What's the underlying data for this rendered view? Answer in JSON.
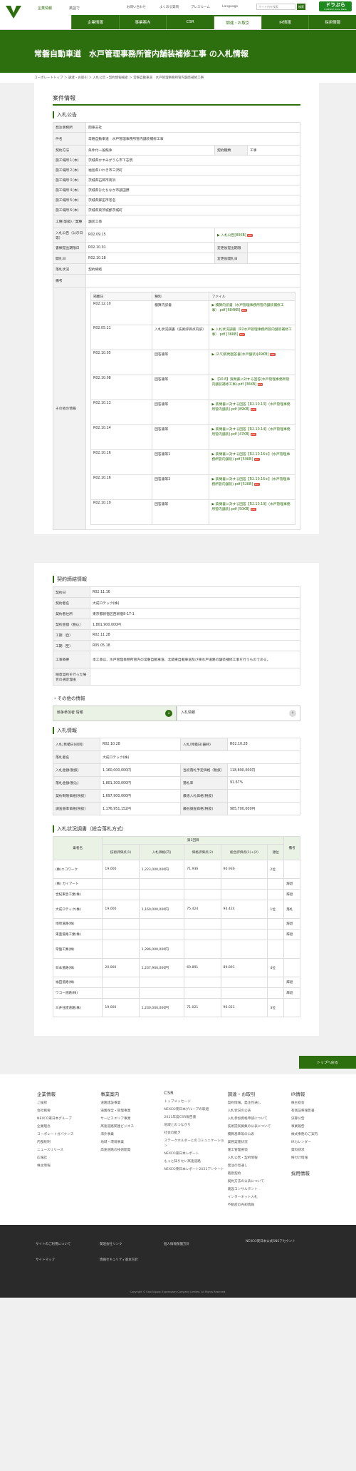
{
  "header": {
    "logo_alt": "NEXCO東日本",
    "group": "企業情報",
    "lang_label": "英語で",
    "util": [
      "お問い合わせ",
      "よくある質問",
      "プレスルーム",
      "Language"
    ],
    "search_placeholder": "サイト内を検索",
    "search_button": "検索",
    "brand": "ドラぷら",
    "brand_sub": "E-NEXCO Drive Plaza"
  },
  "nav": [
    "企業情報",
    "事業案内",
    "CSR",
    "調達・お取引",
    "IR情報",
    "採用情報"
  ],
  "page": {
    "title": "常磐自動車道　水戸管理事務所管内舗装補修工事 の入札情報"
  },
  "breadcrumb": "コーポレートトップ ＞ 調達・お取引 ＞ 入札公告・契約情報検索 ＞ 常磐自動車道　水戸管理事務所管内舗装補修工事",
  "case": {
    "heading": "案件情報",
    "notice_heading": "入札公告",
    "rows": [
      {
        "l": "発注事務所",
        "v": "関東支社"
      },
      {
        "l": "件名",
        "v": "常磐自動車道　水戸管理事務所管内舗装補修工事"
      },
      {
        "l": "契約方法",
        "v": "条件付一般競争",
        "l2": "契約種類",
        "v2": "工事"
      },
      {
        "l": "施工場所１(本)",
        "v": "茨城県かすみがうら市下志筑"
      },
      {
        "l": "施工場所２(本)",
        "v": "福島県いわき市三沢町"
      },
      {
        "l": "施工場所３(本)",
        "v": "茨城県石岡市高浜"
      },
      {
        "l": "施工場所４(本)",
        "v": "茨城県ひたちなか市部田野"
      },
      {
        "l": "施工場所５(本)",
        "v": "茨城県鉾田市巻名"
      },
      {
        "l": "施工場所６(本)",
        "v": "茨城県東茨城郡茨城町"
      },
      {
        "l": "工種(等級)／業種",
        "v": "舗装工事"
      }
    ],
    "koukoku_date_label": "入札公告（公示日等）",
    "koukoku_date": "R02.09.15",
    "koukoku_file": "入札公告[80KB]",
    "submit_label": "書類提出期限日",
    "submit": "R02.10.01",
    "change1_label": "変更後提出期限",
    "change1": "",
    "open_label": "開札日",
    "open": "R02.10.28",
    "change2_label": "変更後開札日",
    "change2": "",
    "result_label": "落札状況",
    "result": "契約締結",
    "note_label": "備考",
    "note": "",
    "other_label": "その他の情報",
    "other_headers": [
      "掲載日",
      "種別",
      "ファイル"
    ],
    "other": [
      {
        "d": "R02.12.10",
        "t": "積算内訳書",
        "f": "積算内訳書（水戸管理事務所管内舗装補修工事）.pdf [684KB]"
      },
      {
        "d": "R02.05.21",
        "t": "入札状況調書（技術評価点内訳）",
        "f": "入札状況調書（R2水戸管理事務所管内舗装補修工事）.pdf [36KB]"
      },
      {
        "d": "R02.10.05",
        "t": "回答書等",
        "f": "(2.5)質問回答書(水戸舗装)[49KB]"
      },
      {
        "d": "R02.10.08",
        "t": "回答書等",
        "f": "【10.8】質問書に対する回答(水戸管理事務所管内舗装補修工事).pdf [36KB]"
      },
      {
        "d": "R02.10.13",
        "t": "回答書等",
        "f": "質問書に対する回答【R2.10.13】(水戸管理事務所管内舗装).pdf [89KB]"
      },
      {
        "d": "R02.10.14",
        "t": "回答書等",
        "f": "質問書に対する回答【R2.10.14】(水戸管理事務所管内舗装).pdf [47KB]"
      },
      {
        "d": "R02.10.16",
        "t": "回答書等1",
        "f": "質問書に対する回答【R2.10.16①】(水戸管理事務所管内舗装).pdf [59KB]"
      },
      {
        "d": "R02.10.16",
        "t": "回答書等2",
        "f": "質問書に対する回答【R2.10.16②】(水戸管理事務所管内舗装).pdf [52KB]"
      },
      {
        "d": "R02.10.19",
        "t": "回答書等",
        "f": "質問書に対する回答【R2.10.19】(水戸管理事務所管内舗装).pdf [50KB]"
      }
    ]
  },
  "contract": {
    "heading": "契約締結情報",
    "rows": [
      {
        "l": "契約日",
        "v": "R02.11.16"
      },
      {
        "l": "契約者名",
        "v": "大成ロテック(株)"
      },
      {
        "l": "契約者住所",
        "v": "東京都新宿区西新宿8-17-1"
      },
      {
        "l": "契約金額（税込）",
        "v": "1,801,900,000円"
      },
      {
        "l": "工期（自）",
        "v": "R02.11.28"
      },
      {
        "l": "工期（至）",
        "v": "R05.05.18"
      },
      {
        "l": "工事概要",
        "v": "本工事は、水戸管理事務所管内の常磐自動車道、北関東自動車道及び東水戸道路の舗装補修工事を行うものである。"
      },
      {
        "l": "随意契約を行った場合の選定理由",
        "v": ""
      }
    ]
  },
  "other_info": {
    "heading": "その他の情報",
    "tabs": [
      "競争参加者 情報",
      "入札情報"
    ],
    "tab_icons": [
      "↓",
      "↑"
    ]
  },
  "bid": {
    "heading": "入札情報",
    "rows": [
      {
        "l": "入札/見積日(初回)",
        "v": "R02.10.28",
        "l2": "入札/見積日(最終)",
        "v2": "R02.10.28"
      },
      {
        "l": "落札者名",
        "v": "大成ロテック(株)",
        "l2": "",
        "v2": ""
      },
      {
        "l": "入札金額(税抜)",
        "v": "1,160,000,000円",
        "l2": "当初落札予定価格（税抜）",
        "v2": "118,890,000円"
      },
      {
        "l": "落札金額(税込)",
        "v": "1,801,300,000円",
        "l2": "落札率",
        "v2": "91.67%"
      },
      {
        "l": "契約制限価格(税抜)",
        "v": "1,697,900,000円",
        "l2": "最適入札価格(税抜)",
        "v2": ""
      },
      {
        "l": "調査基準価格(税抜)",
        "v": "1,176,951,152円",
        "l2": "最低調査価格(税抜)",
        "v2": "985,700,000円"
      }
    ]
  },
  "status": {
    "heading": "入札状況調書（総合落札方式）",
    "round": "第1回目",
    "headers": [
      "業者名",
      "技術評価点(1)",
      "入札価格(円)",
      "価格評価点(2)",
      "総合評価点(1)+(2)",
      "順位",
      "備考"
    ],
    "rows": [
      [
        "(株)エコワーク",
        "19.000",
        "1,223,000,000円",
        "71.936",
        "90.936",
        "2位",
        ""
      ],
      [
        "(株) ガイアート",
        "",
        "",
        "",
        "",
        "",
        "辞退"
      ],
      [
        "世紀東急工業(株)",
        "",
        "",
        "",
        "",
        "",
        "辞退"
      ],
      [
        "大成ロテック(株)",
        "19.000",
        "1,160,000,000円",
        "75.424",
        "94.424",
        "1位",
        "落札"
      ],
      [
        "地崎道路(株)",
        "",
        "",
        "",
        "",
        "",
        "辞退"
      ],
      [
        "東亜道路工業(株)",
        "",
        "",
        "",
        "",
        "",
        "辞退"
      ],
      [
        "常盤工業(株)",
        "",
        "1,286,000,000円",
        "",
        "",
        "",
        ""
      ],
      [
        "日本道路(株)",
        "20.000",
        "1,237,900,000円",
        "69.891",
        "89.891",
        "4位",
        ""
      ],
      [
        "福田道路(株)",
        "",
        "",
        "",
        "",
        "",
        "辞退"
      ],
      [
        "ワコー道路(株)",
        "",
        "",
        "",
        "",
        "",
        "辞退"
      ],
      [
        "三井住建道路(株)",
        "19.000",
        "1,230,000,000円",
        "71.021",
        "90.021",
        "3位",
        ""
      ]
    ]
  },
  "totop": "トップへ戻る",
  "footer": {
    "cols": [
      {
        "h": "企業情報",
        "items": [
          "ご挨拶",
          "会社概要",
          "NEXCO東日本グループ",
          "企業理念",
          "コーポレートガバナンス",
          "内部統制",
          "ニュースリリース",
          "広報誌",
          "株主情報"
        ]
      },
      {
        "h": "事業案内",
        "items": [
          "道路建設事業",
          "道路保全・管理事業",
          "サービスエリア事業",
          "高速道路関連ビジネス",
          "海外事業",
          "地域・環境事業",
          "高速道路の技術開発"
        ]
      },
      {
        "h": "CSR",
        "items": [
          "トップメッセージ",
          "NEXCO東日本グループの取組",
          "2021年度CSR報告書",
          "地域とのつながり",
          "社会の動き",
          "ステークホルダーとのコミュニケーション",
          "NEXCO東日本レポート",
          "もっと知りたい高速道路",
          "NEXCO東日本レポート2021アンケート"
        ]
      },
      {
        "h": "調達・お取引",
        "items": [
          "契約情報、発注見通し",
          "入札状況の公表",
          "入札参加資格申請について",
          "技術提案募集の公表について",
          "積算基準等の公表",
          "業務実施状況",
          "施工管理要領",
          "入札公告・契約情報",
          "発注の見通し",
          "随意契約",
          "契約方法の公表について",
          "建設コンサルタント",
          "インターネット入札",
          "不動産の売却情報"
        ]
      },
      {
        "h": "IR情報",
        "items": [
          "株主総会",
          "有価証券報告書",
          "決算公告",
          "事業報告",
          "株式事務のご案内",
          "IRカレンダー",
          "資料請求",
          "格付け情報"
        ]
      }
    ],
    "extra_h": "採用情報",
    "bottom": [
      "サイトのご利用について",
      "関連会社リンク",
      "個人情報保護方針",
      "NEXCO東日本公式SNSアカウント",
      "サイトマップ",
      "情報セキュリティ基本方針"
    ],
    "copyright": "Copyright © East Nippon Expressway Company Limited. All Rights Reserved."
  }
}
